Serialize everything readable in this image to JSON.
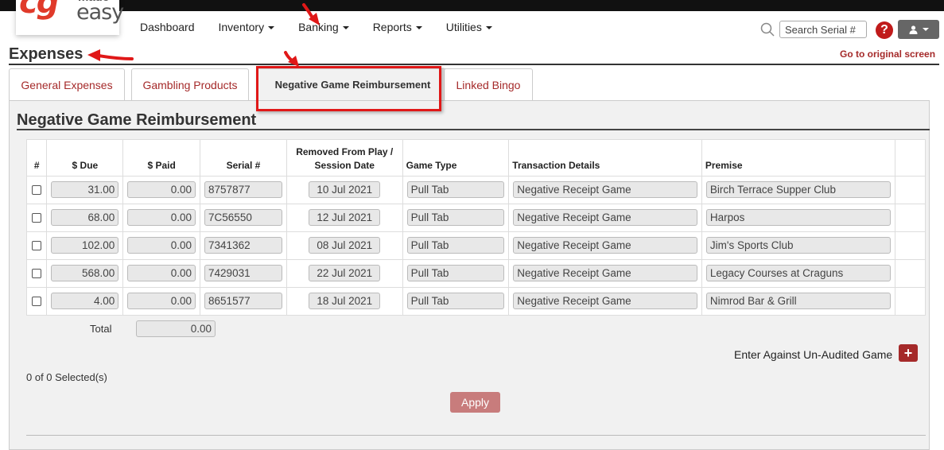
{
  "logo": {
    "made": "made",
    "easy": "easy"
  },
  "nav": {
    "items": [
      {
        "label": "Dashboard",
        "caret": false
      },
      {
        "label": "Inventory",
        "caret": true
      },
      {
        "label": "Banking",
        "caret": true
      },
      {
        "label": "Reports",
        "caret": true
      },
      {
        "label": "Utilities",
        "caret": true
      }
    ]
  },
  "search": {
    "placeholder": "Search Serial #"
  },
  "help": {
    "symbol": "?"
  },
  "page": {
    "title": "Expenses",
    "original_link": "Go to original screen"
  },
  "tabs": [
    {
      "label": "General Expenses",
      "active": false
    },
    {
      "label": "Gambling Products",
      "active": false
    },
    {
      "label": "Negative Game Reimbursement",
      "active": true
    },
    {
      "label": "Linked Bingo",
      "active": false
    }
  ],
  "section": {
    "title": "Negative Game Reimbursement"
  },
  "table": {
    "headers": {
      "num": "#",
      "due": "$ Due",
      "paid": "$ Paid",
      "serial": "Serial #",
      "removed_line1": "Removed From Play /",
      "removed_line2": "Session Date",
      "game_type": "Game Type",
      "details": "Transaction Details",
      "premise": "Premise"
    },
    "rows": [
      {
        "due": "31.00",
        "paid": "0.00",
        "serial": "8757877",
        "date": "10 Jul 2021",
        "game_type": "Pull Tab",
        "details": "Negative Receipt Game",
        "premise": "Birch Terrace Supper Club"
      },
      {
        "due": "68.00",
        "paid": "0.00",
        "serial": "7C56550",
        "date": "12 Jul 2021",
        "game_type": "Pull Tab",
        "details": "Negative Receipt Game",
        "premise": "Harpos"
      },
      {
        "due": "102.00",
        "paid": "0.00",
        "serial": "7341362",
        "date": "08 Jul 2021",
        "game_type": "Pull Tab",
        "details": "Negative Receipt Game",
        "premise": "Jim's Sports Club"
      },
      {
        "due": "568.00",
        "paid": "0.00",
        "serial": "7429031",
        "date": "22 Jul 2021",
        "game_type": "Pull Tab",
        "details": "Negative Receipt Game",
        "premise": "Legacy Courses at Craguns"
      },
      {
        "due": "4.00",
        "paid": "0.00",
        "serial": "8651577",
        "date": "18 Jul 2021",
        "game_type": "Pull Tab",
        "details": "Negative Receipt Game",
        "premise": "Nimrod Bar & Grill"
      }
    ],
    "total_label": "Total",
    "total_value": "0.00"
  },
  "enter_label": "Enter Against Un-Audited Game",
  "plus_symbol": "+",
  "selected_text": "0 of 0 Selected(s)",
  "apply_label": "Apply",
  "colors": {
    "accent": "#a52a2a",
    "highlight": "#e01818",
    "apply": "#c87c7c"
  }
}
